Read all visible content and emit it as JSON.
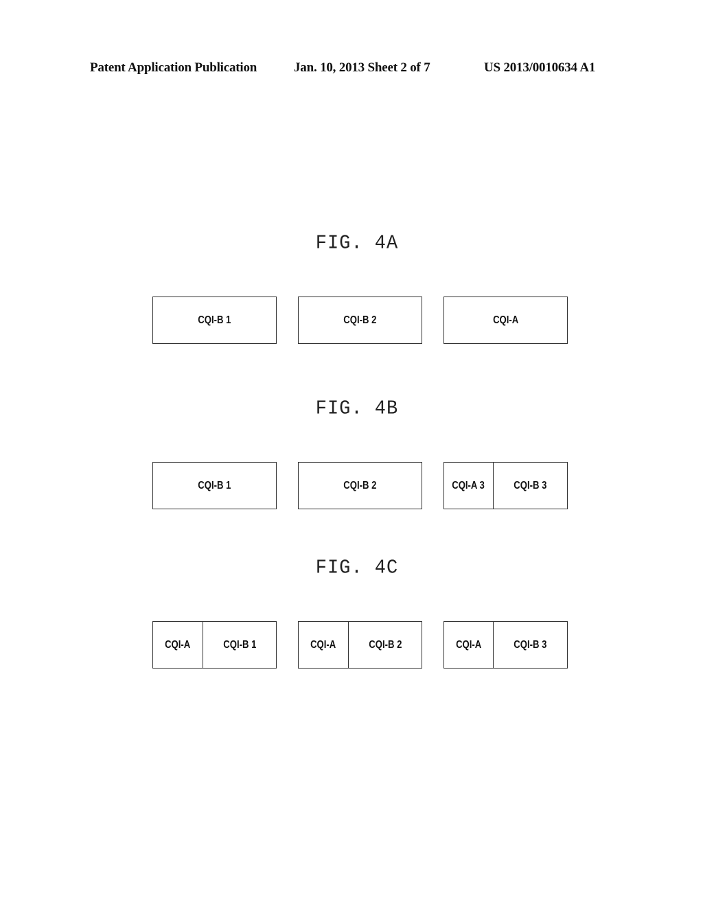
{
  "header": {
    "publication": "Patent Application Publication",
    "date_sheet": "Jan. 10, 2013  Sheet 2 of 7",
    "number": "US 2013/0010634 A1"
  },
  "figures": [
    {
      "title": "FIG. 4A",
      "boxes": [
        {
          "cells": [
            "CQI-B 1"
          ]
        },
        {
          "cells": [
            "CQI-B 2"
          ]
        },
        {
          "cells": [
            "CQI-A"
          ]
        }
      ]
    },
    {
      "title": "FIG. 4B",
      "boxes": [
        {
          "cells": [
            "CQI-B 1"
          ]
        },
        {
          "cells": [
            "CQI-B 2"
          ]
        },
        {
          "cells": [
            "CQI-A 3",
            "CQI-B 3"
          ]
        }
      ]
    },
    {
      "title": "FIG. 4C",
      "boxes": [
        {
          "cells": [
            "CQI-A",
            "CQI-B 1"
          ]
        },
        {
          "cells": [
            "CQI-A",
            "CQI-B 2"
          ]
        },
        {
          "cells": [
            "CQI-A",
            "CQI-B 3"
          ]
        }
      ]
    }
  ]
}
